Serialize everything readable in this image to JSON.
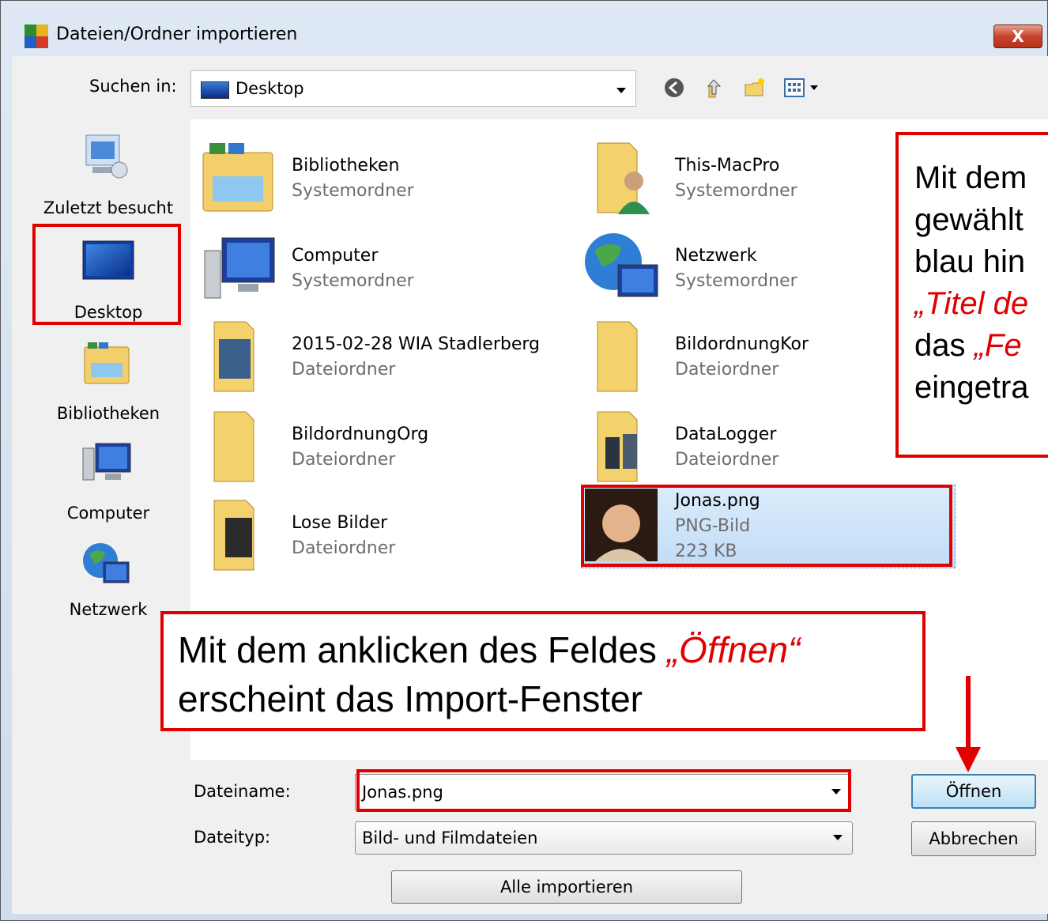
{
  "window": {
    "title": "Dateien/Ordner importieren",
    "close_label": "X"
  },
  "toolbar": {
    "lookin_label": "Suchen in:",
    "lookin_value": "Desktop",
    "icons": [
      "back-icon",
      "up-folder-icon",
      "new-folder-icon",
      "view-menu-icon"
    ]
  },
  "places": [
    {
      "label": "Zuletzt besucht",
      "icon": "recent-places-icon"
    },
    {
      "label": "Desktop",
      "icon": "desktop-icon",
      "highlighted": true
    },
    {
      "label": "Bibliotheken",
      "icon": "libraries-icon"
    },
    {
      "label": "Computer",
      "icon": "computer-icon"
    },
    {
      "label": "Netzwerk",
      "icon": "network-icon"
    }
  ],
  "items": [
    {
      "name": "Bibliotheken",
      "sub": "Systemordner",
      "icon": "libraries-icon"
    },
    {
      "name": "This-MacPro",
      "sub": "Systemordner",
      "icon": "user-folder-icon"
    },
    {
      "name": "Computer",
      "sub": "Systemordner",
      "icon": "computer-icon"
    },
    {
      "name": "Netzwerk",
      "sub": "Systemordner",
      "icon": "network-icon"
    },
    {
      "name": "2015-02-28 WIA Stadlerberg",
      "sub": "Dateiordner",
      "icon": "folder-icon"
    },
    {
      "name": "BildordnungKor",
      "sub": "Dateiordner",
      "icon": "folder-icon"
    },
    {
      "name": "BildordnungOrg",
      "sub": "Dateiordner",
      "icon": "folder-icon"
    },
    {
      "name": "DataLogger",
      "sub": "Dateiordner",
      "icon": "folder-icon"
    },
    {
      "name": "Lose Bilder",
      "sub": "Dateiordner",
      "icon": "folder-icon"
    },
    {
      "name": "Jonas.png",
      "sub": "PNG-Bild",
      "size": "223 KB",
      "icon": "image-thumbnail",
      "selected": true
    }
  ],
  "notes": {
    "right_line1": "Mit dem",
    "right_line2": "gewählt",
    "right_line3": "blau hin",
    "right_line4": "„Titel de",
    "right_line5a": "das ",
    "right_line5b": "„Fe",
    "right_line6": "eingetra",
    "bottom_line1a": "Mit dem anklicken des Feldes ",
    "bottom_line1b": "„Öffnen“",
    "bottom_line2": "erscheint das Import-Fenster"
  },
  "form": {
    "filename_label": "Dateiname:",
    "filename_value": "Jonas.png",
    "filetype_label": "Dateityp:",
    "filetype_value": "Bild- und Filmdateien",
    "import_all": "Alle importieren",
    "open": "Öffnen",
    "cancel": "Abbrechen"
  },
  "colors": {
    "annotation": "#e00000",
    "selection": "#c1dcf6"
  }
}
